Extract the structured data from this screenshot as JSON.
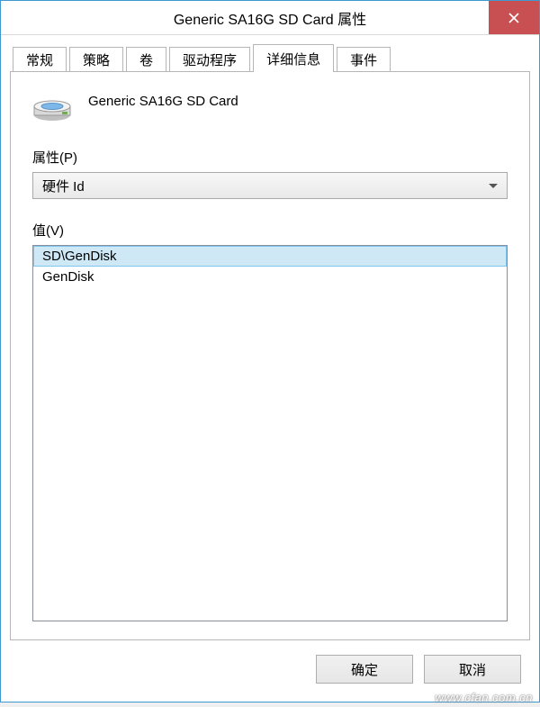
{
  "window": {
    "title": "Generic SA16G SD Card 属性"
  },
  "tabs": {
    "t0": "常规",
    "t1": "策略",
    "t2": "卷",
    "t3": "驱动程序",
    "t4": "详细信息",
    "t5": "事件"
  },
  "device": {
    "name": "Generic SA16G SD Card"
  },
  "labels": {
    "property": "属性(P)",
    "value": "值(V)"
  },
  "combo": {
    "selected": "硬件 Id"
  },
  "values": {
    "v0": "SD\\GenDisk",
    "v1": "GenDisk"
  },
  "buttons": {
    "ok": "确定",
    "cancel": "取消"
  },
  "watermark": "www.cfan.com.cn"
}
